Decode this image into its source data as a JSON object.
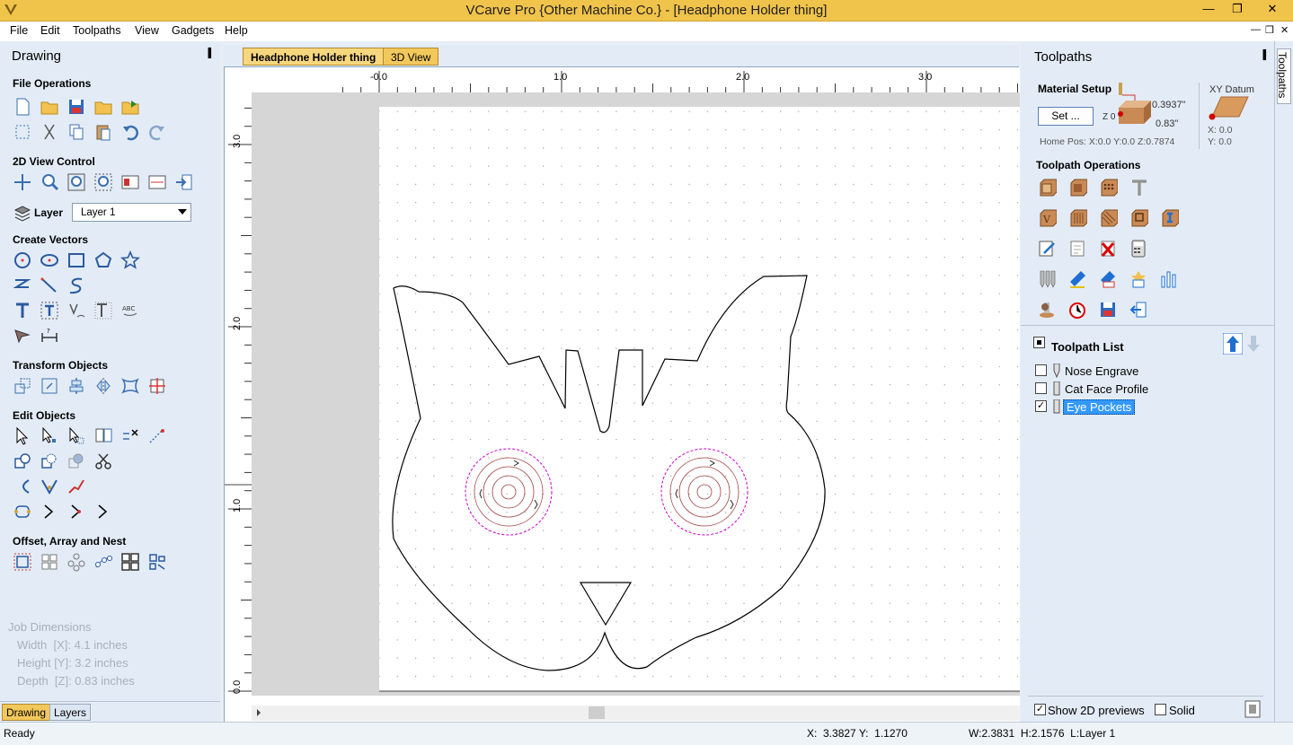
{
  "window": {
    "title": "VCarve Pro {Other Machine Co.} - [Headphone Holder thing]",
    "minimize": "—",
    "restore": "❐",
    "close": "✕"
  },
  "menu": {
    "file": "File",
    "edit": "Edit",
    "toolpaths": "Toolpaths",
    "view": "View",
    "gadgets": "Gadgets",
    "help": "Help"
  },
  "mdi": {
    "minimize": "—",
    "restore": "❐",
    "close": "✕"
  },
  "left_panel": {
    "title": "Drawing",
    "pin": "▐",
    "sections": {
      "file_operations": "File Operations",
      "view_control": "2D View Control",
      "create_vectors": "Create Vectors",
      "transform_objects": "Transform Objects",
      "edit_objects": "Edit Objects",
      "offset_array_nest": "Offset, Array and Nest"
    },
    "layer_label": "Layer",
    "layer_value": "Layer 1",
    "job_dimensions": {
      "title": "Job Dimensions",
      "width": "Width  [X]: 4.1 inches",
      "height": "Height [Y]: 3.2 inches",
      "depth": "Depth  [Z]: 0.83 inches"
    },
    "tabs": {
      "drawing": "Drawing",
      "layers": "Layers"
    }
  },
  "doc_tabs": {
    "active": "Headphone Holder thing",
    "view3d": "3D View"
  },
  "ruler": {
    "x_labels": [
      "-0.0",
      "1.0",
      "2.0",
      "3.0"
    ],
    "y_labels": [
      "3.0",
      "2.0",
      "1.0",
      "0.0"
    ]
  },
  "right_panel": {
    "title": "Toolpaths",
    "pin": "▐",
    "side_tab": "Toolpaths",
    "material_setup": {
      "title": "Material Setup",
      "set_button": "Set ...",
      "z0": "Z 0",
      "thickness_top": "0.3937\"",
      "thickness_bottom": "0.83\"",
      "home_pos": "Home Pos:  X:0.0 Y:0.0 Z:0.7874"
    },
    "xy_datum": {
      "title": "XY Datum",
      "x": "X: 0.0",
      "y": "Y: 0.0"
    },
    "toolpath_operations": "Toolpath Operations",
    "toolpath_list": {
      "title": "Toolpath List",
      "items": [
        {
          "name": "Nose Engrave",
          "checked": false
        },
        {
          "name": "Cat Face Profile",
          "checked": false
        },
        {
          "name": "Eye Pockets",
          "checked": true
        }
      ]
    },
    "show_2d_previews": "Show 2D previews",
    "solid": "Solid"
  },
  "status": {
    "ready": "Ready",
    "coords": "X:  3.3827 Y:  1.1270",
    "size": "W:2.3831  H:2.1576  L:Layer 1"
  },
  "colors": {
    "titlebar": "#f0c34b",
    "panel_bg": "#e3ecf6",
    "accent_blue": "#1f6fd1",
    "selection": "#3399ff",
    "toolpath_pink": "#cc00cc",
    "toolpath_brown": "#a04040"
  }
}
